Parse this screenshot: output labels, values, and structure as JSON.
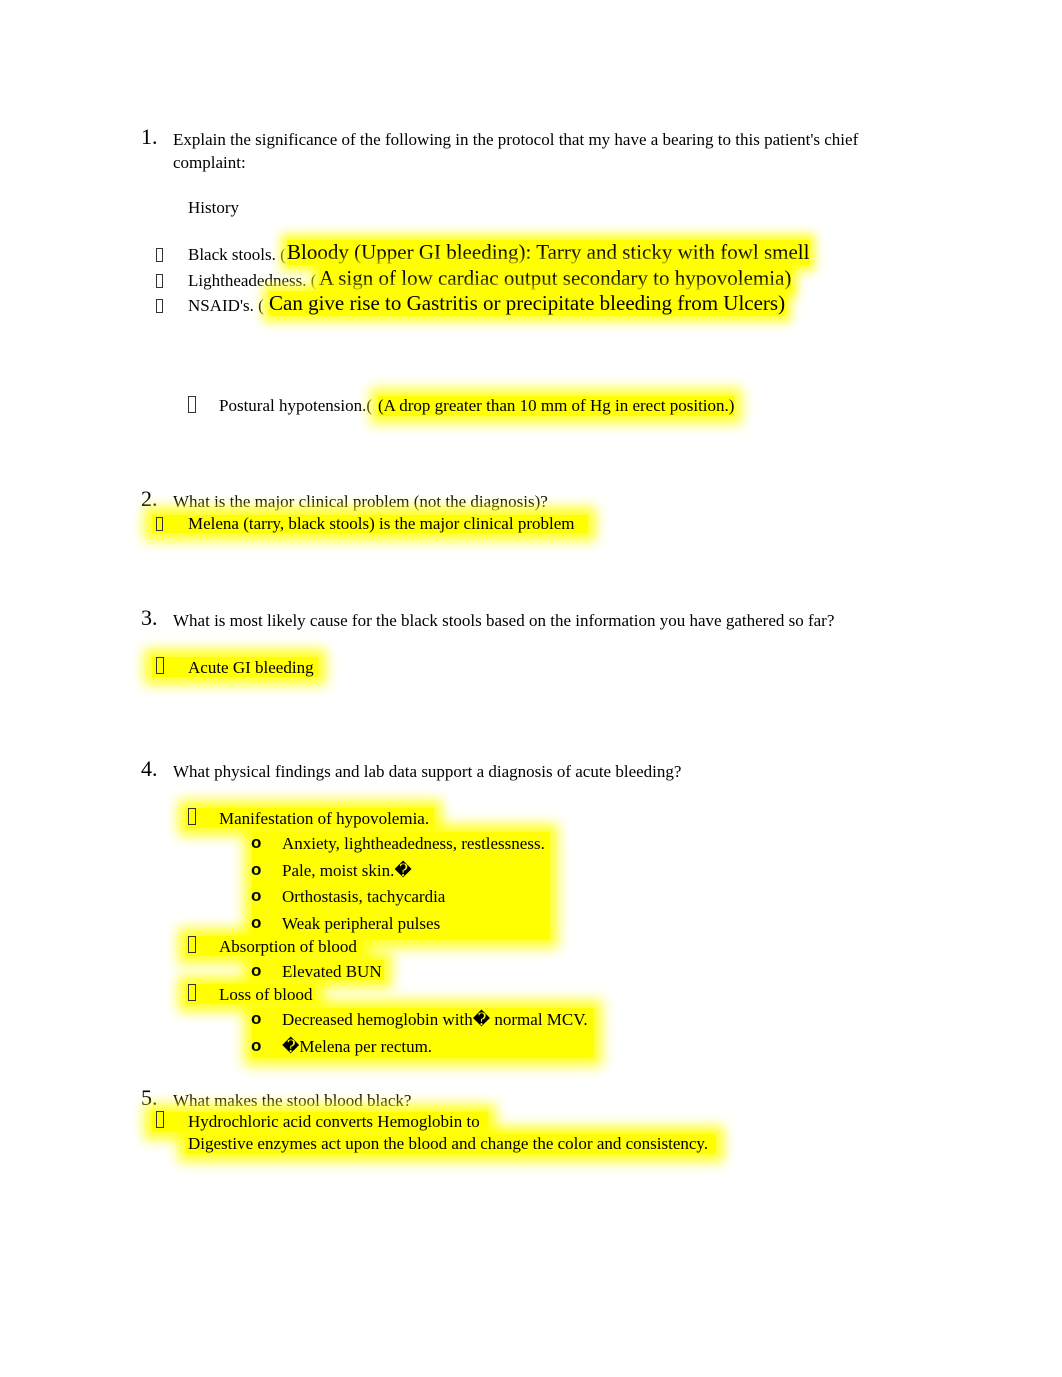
{
  "questions": [
    {
      "number": "1.",
      "text_line1": "Explain the significance of the following in the protocol that my have a bearing to this patient's chief",
      "text_line2": "complaint:",
      "subheading": "History",
      "items": [
        {
          "label": "Black stools. (",
          "answer": "Bloody (Upper GI bleeding): Tarry and sticky  with fowl smell"
        },
        {
          "label": "Lightheadedness. (",
          "answer": "A sign of low cardiac output secondary to hypovolemia)"
        },
        {
          "label": "NSAID's. ( ",
          "answer": "Can give rise to Gastritis or precipitate bleeding from Ulcers)"
        },
        {
          "label": "Postural hypotension.( ",
          "answer": "(A drop greater than 10 mm of Hg in erect position.)"
        }
      ]
    },
    {
      "number": "2.",
      "text": "What is the major clinical problem (not the diagnosis)?",
      "answer": "Melena (tarry, black stools) is the major clinical problem"
    },
    {
      "number": "3.",
      "text": "What is most likely cause for the black stools based on the information you have gathered so far?",
      "answer": "Acute GI bleeding"
    },
    {
      "number": "4.",
      "text": "What physical findings and lab data support a diagnosis of acute bleeding?",
      "groups": [
        {
          "label": "Manifestation of hypovolemia.",
          "subitems": [
            "Anxiety, lightheadedness, restlessness.",
            "Pale, moist skin.�",
            "Orthostasis, tachycardia",
            "Weak peripheral pulses"
          ]
        },
        {
          "label": "Absorption of blood",
          "subitems": [
            "Elevated BUN"
          ]
        },
        {
          "label": "Loss of blood",
          "subitems": [
            "Decreased hemoglobin with� normal MCV.",
            "�Melena per rectum."
          ]
        }
      ],
      "sub_bullet": "o"
    },
    {
      "number": "5.",
      "text": "What makes the stool blood black?",
      "answer_line1": "Hydrochloric acid converts Hemoglobin to",
      "answer_line2": "Digestive enzymes act upon the blood and change the color and consistency."
    }
  ],
  "colors": {
    "highlight": "#ffff00",
    "text": "#000000"
  }
}
